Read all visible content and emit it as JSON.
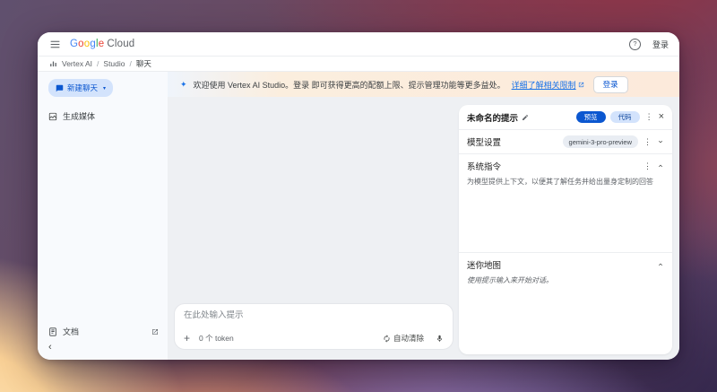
{
  "topbar": {
    "logo_google_letters": [
      "G",
      "o",
      "o",
      "g",
      "l",
      "e"
    ],
    "logo_cloud": "Cloud",
    "help_glyph": "?",
    "signin": "登录"
  },
  "breadcrumb": {
    "items": [
      "Vertex AI",
      "Studio",
      "聊天"
    ],
    "separator": "/"
  },
  "sidebar": {
    "new_chat_label": "新建聊天",
    "new_chat_caret": "▾",
    "generate_media_label": "生成媒体",
    "docs_label": "文档",
    "collapse_glyph": "‹"
  },
  "banner": {
    "spark_glyph": "✦",
    "message": "欢迎使用 Vertex AI Studio。登录 即可获得更高的配额上限、提示管理功能等更多益处。",
    "link_label": "详细了解相关限制",
    "signin_button": "登录"
  },
  "prompt": {
    "placeholder": "在此处输入提示",
    "plus_glyph": "+",
    "token_count": "0 个 token",
    "auto_clear_label": "自动清除"
  },
  "panel": {
    "title": "未命名的提示",
    "preview_button": "预览",
    "code_button": "代码",
    "more_glyph": "⋮",
    "close_glyph": "×",
    "model_settings_label": "模型设置",
    "model_name": "gemini-3-pro-preview",
    "system_instructions_label": "系统指令",
    "system_instructions_hint": "为模型提供上下文，以便其了解任务并给出量身定制的回答",
    "minimap_label": "迷你地图",
    "minimap_hint": "使用提示输入来开始对话。"
  },
  "icons": {
    "hamburger-menu-icon": "three horizontal lines",
    "help-icon": "question mark in circle",
    "vertex-ai-icon": "spark bars",
    "chat-bubble-icon": "filled speech bubble",
    "media-icon": "image frame",
    "doc-icon": "document page",
    "external-link-icon": "box with arrow",
    "edit-icon": "pencil",
    "refresh-icon": "circular arrows",
    "mic-icon": "microphone",
    "chevron-down-icon": "v",
    "chevron-up-icon": "^"
  },
  "colors": {
    "accent_blue": "#0b57d0",
    "light_blue_pill": "#d3e3fc",
    "link_blue": "#1a73e8",
    "banner_peach": "#fceadb",
    "main_gray": "#eef0f3",
    "google_letter_colors": [
      "#4285F4",
      "#EA4335",
      "#FBBC05",
      "#4285F4",
      "#34A853",
      "#EA4335"
    ]
  }
}
